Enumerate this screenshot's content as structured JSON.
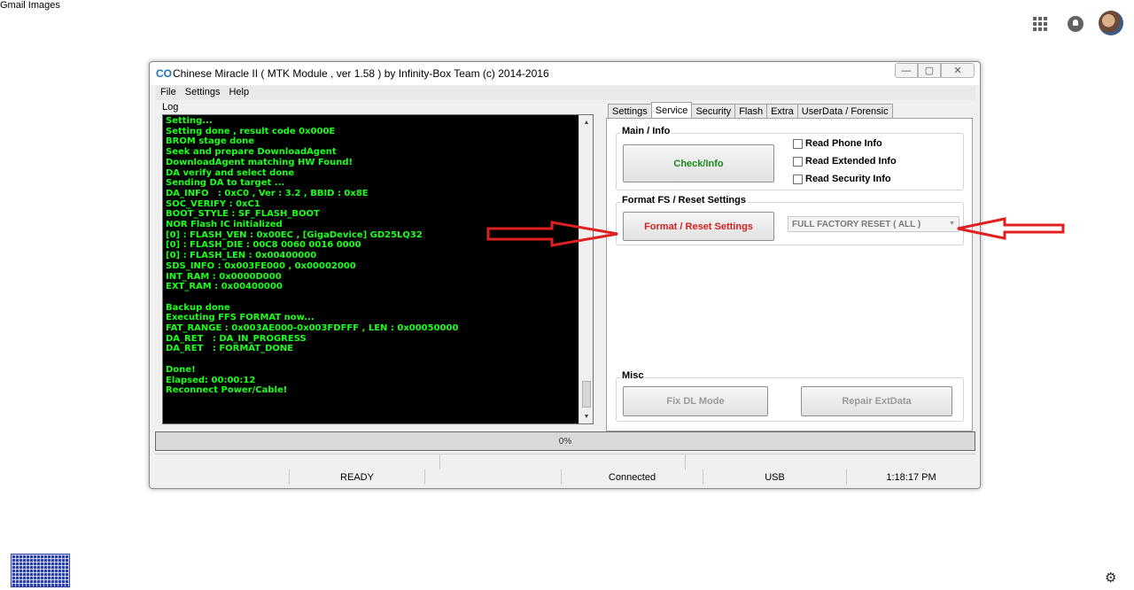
{
  "google_bar": {
    "gmail": "Gmail",
    "images": "Images"
  },
  "window": {
    "title": "Chinese Miracle II ( MTK Module , ver 1.58 ) by Infinity-Box Team (c) 2014-2016",
    "logo": "CO",
    "controls": {
      "minimize": "—",
      "maximize": "▢",
      "close": "✕"
    }
  },
  "menu": [
    "File",
    "Settings",
    "Help"
  ],
  "log": {
    "label": "Log",
    "text": "Setting...\nSetting done , result code 0x000E\nBROM stage done\nSeek and prepare DownloadAgent\nDownloadAgent matching HW Found!\nDA verify and select done\nSending DA to target ...\nDA_INFO   : 0xC0 , Ver : 3.2 , BBID : 0x8E\nSOC_VERIFY : 0xC1\nBOOT_STYLE : SF_FLASH_BOOT\nNOR Flash IC initialized\n[0] : FLASH_VEN : 0x00EC , [GigaDevice] GD25LQ32\n[0] : FLASH_DIE : 00C8 0060 0016 0000\n[0] : FLASH_LEN : 0x00400000\nSDS_INFO : 0x003FE000 , 0x00002000\nINT_RAM : 0x0000D000\nEXT_RAM : 0x00400000\n\nBackup done\nExecuting FFS FORMAT now...\nFAT_RANGE : 0x003AE000-0x003FDFFF , LEN : 0x00050000\nDA_RET   : DA_IN_PROGRESS\nDA_RET   : FORMAT_DONE\n\nDone!\nElapsed: 00:00:12\nReconnect Power/Cable!"
  },
  "tabs": [
    "Settings",
    "Service",
    "Security",
    "Flash",
    "Extra",
    "UserData / Forensic"
  ],
  "service": {
    "main_info": {
      "title": "Main / Info",
      "check_button": "Check/Info",
      "checkboxes": [
        "Read Phone Info",
        "Read Extended Info",
        "Read Security Info"
      ]
    },
    "format": {
      "title": "Format FS / Reset Settings",
      "button": "Format / Reset Settings",
      "select_value": "FULL FACTORY RESET ( ALL )"
    },
    "misc": {
      "title": "Misc",
      "fix_dl": "Fix DL Mode",
      "repair": "Repair ExtData"
    }
  },
  "progress": {
    "label": "0%",
    "value": 0
  },
  "status": {
    "ready": "READY",
    "connection": "Connected",
    "port": "USB",
    "time": "1:18:17 PM"
  },
  "colors": {
    "log_text": "#1aff1a",
    "check_button_text": "#1a8a1a",
    "format_button_text": "#d42020",
    "arrow": "#e02020"
  },
  "icons": {
    "gear": "⚙",
    "dropdown": "▼",
    "scroll_up": "▲",
    "scroll_down": "▼"
  }
}
